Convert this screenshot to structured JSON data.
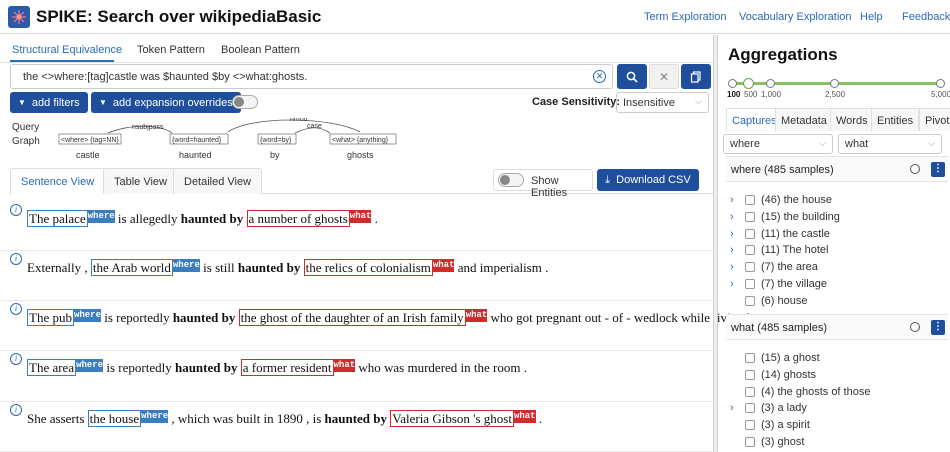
{
  "header": {
    "title": "SPIKE: Search over wikipediaBasic",
    "nav": [
      "Term Exploration",
      "Vocabulary Exploration",
      "Help",
      "Feedback"
    ]
  },
  "query": {
    "tabs": [
      "Structural Equivalence",
      "Token Pattern",
      "Boolean Pattern"
    ],
    "active_tab": 0,
    "text": "the <>where:[tag]castle was $haunted $by <>what:ghosts.",
    "add_filters": "add filters",
    "add_expansion": "add expansion overrides",
    "case_sensitivity_label": "Case Sensitivity:",
    "case_sensitivity_value": "Insensitive"
  },
  "query_graph": {
    "label_line1": "Query",
    "label_line2": "Graph",
    "nodes": [
      "<where> {tag=NN}",
      "{word=haunted}",
      "{word=by}",
      "<what> {anything}"
    ],
    "words": [
      "castle",
      "haunted",
      "by",
      "ghosts"
    ],
    "edges": [
      "nsubjpass",
      "nmod",
      "case"
    ]
  },
  "results_tabs": {
    "tabs": [
      "Sentence View",
      "Table View",
      "Detailed View"
    ],
    "active": 0,
    "show_entities": "Show Entities",
    "download": "Download CSV"
  },
  "results": [
    {
      "segments": [
        {
          "t": "The palace",
          "cap": "where"
        },
        {
          "t": " is allegedly "
        },
        {
          "t": "haunted by",
          "bold": true
        },
        {
          "t": " "
        },
        {
          "t": "a number of ghosts",
          "cap": "what"
        },
        {
          "t": " ."
        }
      ]
    },
    {
      "segments": [
        {
          "t": "Externally , "
        },
        {
          "t": "the Arab world",
          "cap": "where"
        },
        {
          "t": " is still "
        },
        {
          "t": "haunted by",
          "bold": true
        },
        {
          "t": " "
        },
        {
          "t": "the relics of colonialism",
          "cap": "what"
        },
        {
          "t": " and imperialism ."
        }
      ]
    },
    {
      "segments": [
        {
          "t": "The pub",
          "cap": "where"
        },
        {
          "t": " is reportedly "
        },
        {
          "t": "haunted by",
          "bold": true
        },
        {
          "t": " "
        },
        {
          "t": "the ghost of the daughter of an Irish family",
          "cap": "what"
        },
        {
          "t": " who got pregnant out - of - wedlock while living here ."
        }
      ]
    },
    {
      "segments": [
        {
          "t": "The area",
          "cap": "where"
        },
        {
          "t": " is reportedly "
        },
        {
          "t": "haunted by",
          "bold": true
        },
        {
          "t": " "
        },
        {
          "t": "a former resident",
          "cap": "what"
        },
        {
          "t": " who was murdered in the room ."
        }
      ]
    },
    {
      "segments": [
        {
          "t": "She asserts "
        },
        {
          "t": "the house",
          "cap": "where"
        },
        {
          "t": " , which was built in 1890 , is "
        },
        {
          "t": "haunted by",
          "bold": true
        },
        {
          "t": " "
        },
        {
          "t": "Valeria Gibson 's ghost",
          "cap": "what"
        },
        {
          "t": " ."
        }
      ]
    }
  ],
  "capture_labels": {
    "where": "where",
    "what": "what"
  },
  "aggregations": {
    "title": "Aggregations",
    "slider_labels": [
      "100",
      "500",
      "1,000",
      "2,500",
      "5,000"
    ],
    "slider_selected": "100",
    "tabs": [
      "Captures",
      "Metadata",
      "Words",
      "Entities",
      "Pivot"
    ],
    "active_tab": 0,
    "select_left": "where",
    "select_right": "what",
    "sections": [
      {
        "title": "where (485 samples)",
        "items": [
          {
            "label": "(46) the house",
            "expandable": true
          },
          {
            "label": "(15) the building",
            "expandable": true
          },
          {
            "label": "(11) the castle",
            "expandable": true
          },
          {
            "label": "(11) The hotel",
            "expandable": true
          },
          {
            "label": "(7) the area",
            "expandable": true
          },
          {
            "label": "(7) the village",
            "expandable": true
          },
          {
            "label": "(6) house",
            "expandable": false
          }
        ]
      },
      {
        "title": "what (485 samples)",
        "items": [
          {
            "label": "(15) a ghost",
            "expandable": false
          },
          {
            "label": "(14) ghosts",
            "expandable": false
          },
          {
            "label": "(4) the ghosts of those",
            "expandable": false
          },
          {
            "label": "(3) a lady",
            "expandable": true
          },
          {
            "label": "(3) a spirit",
            "expandable": false
          },
          {
            "label": "(3) ghost",
            "expandable": false
          }
        ]
      }
    ]
  },
  "colors": {
    "primary": "#1f4f9c",
    "link": "#2a6ab6",
    "where": "#3a7ebf",
    "what": "#d42a2a",
    "slider": "#8bbf63"
  }
}
